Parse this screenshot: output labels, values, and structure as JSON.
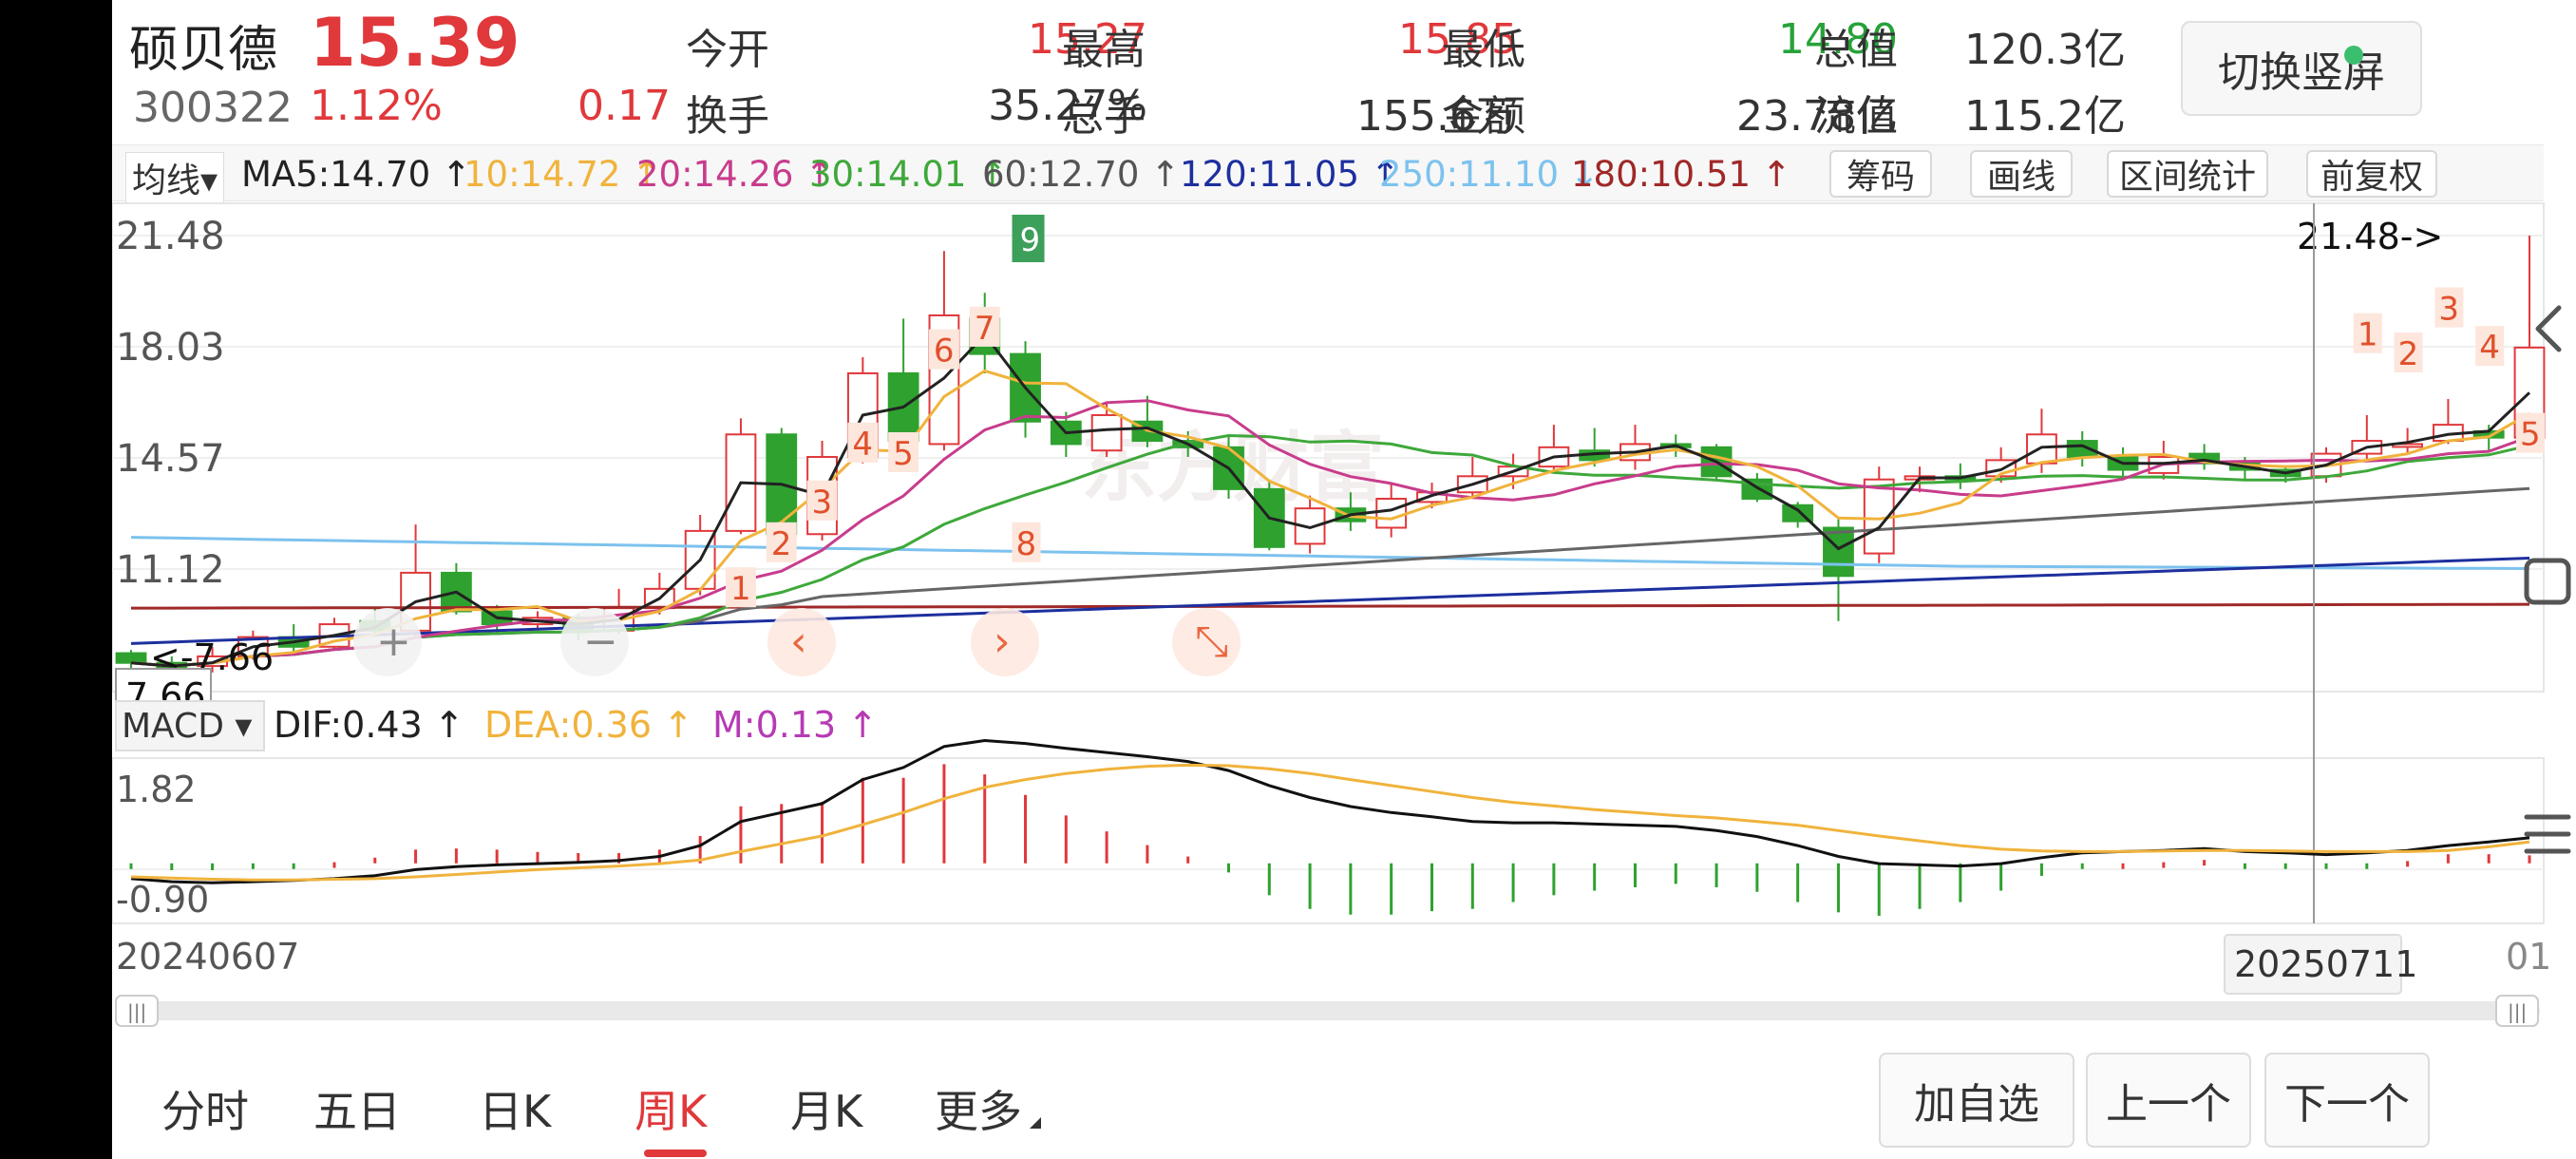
{
  "quote": {
    "name": "硕贝德",
    "price": "15.39",
    "code": "300322",
    "change_pct": "1.12%",
    "change_abs": "0.17",
    "open_label": "今开",
    "open": "15.27",
    "high_label": "最高",
    "high": "15.85",
    "low_label": "最低",
    "low": "14.80",
    "cap_label": "总值",
    "cap": "120.3亿",
    "turnover_label": "换手",
    "turnover": "35.27%",
    "volume_label": "总手",
    "volume": "155.6万",
    "amount_label": "金额",
    "amount": "23.78亿",
    "float_label": "流值",
    "float_cap": "115.2亿",
    "toggle_label": "切换竖屏"
  },
  "ma_bar": {
    "selector": "均线▾",
    "ma5": "MA5:14.70 ↑",
    "ma10": "10:14.72 ↑",
    "ma20": "20:14.26 ↑",
    "ma30": "30:14.01 ↑",
    "ma60": "60:12.70 ↑",
    "ma120": "120:11.05 ↑",
    "ma250": "250:11.10 ↓",
    "ma180": "180:10.51 ↑",
    "chips": "筹码",
    "draw": "画线",
    "range_stats": "区间统计",
    "adjust": "前复权"
  },
  "colors": {
    "up": "#e0383b",
    "down": "#2fa12f",
    "ma5": "#222222",
    "ma10": "#f0b33c",
    "ma20": "#c83c8c",
    "ma30": "#3ea83a",
    "ma60": "#666666",
    "ma120": "#1d2f9e",
    "ma250": "#7cc2ee",
    "ma180": "#a02828"
  },
  "main_chart": {
    "y_labels": [
      "21.48",
      "18.03",
      "14.57",
      "11.12"
    ],
    "max_marker": "21.48->",
    "min_marker": "<-7.66",
    "min_box": "7.66",
    "nine_label": "9",
    "watermark": "东方财富"
  },
  "macd": {
    "selector": "MACD ▾",
    "dif": "DIF:0.43 ↑",
    "dea": "DEA:0.36 ↑",
    "m": "M:0.13 ↑",
    "y_top": "1.82",
    "y_bottom": "-0.90"
  },
  "dates": {
    "start": "20240607",
    "cursor": "20250711",
    "end_partial": "01"
  },
  "tabs": [
    "分时",
    "五日",
    "日K",
    "周K",
    "月K",
    "更多"
  ],
  "active_tab": "周K",
  "buttons": {
    "add_watch": "加自选",
    "prev": "上一个",
    "next": "下一个"
  },
  "chart_data": {
    "type": "candlestick",
    "series": [
      {
        "name": "K",
        "ohlc": [
          [
            8.5,
            8.2,
            8.6,
            8.0
          ],
          [
            8.2,
            8.0,
            8.4,
            7.66
          ],
          [
            8.1,
            8.4,
            8.7,
            7.9
          ],
          [
            8.4,
            9.0,
            9.2,
            8.3
          ],
          [
            9.0,
            8.7,
            9.4,
            8.5
          ],
          [
            8.7,
            9.4,
            9.6,
            8.6
          ],
          [
            9.5,
            9.2,
            9.9,
            9.0
          ],
          [
            9.2,
            11.0,
            12.5,
            9.0
          ],
          [
            11.0,
            9.8,
            11.3,
            9.7
          ],
          [
            9.8,
            9.4,
            10.0,
            9.1
          ],
          [
            9.4,
            9.6,
            9.8,
            9.2
          ],
          [
            9.6,
            9.2,
            9.7,
            8.9
          ],
          [
            9.2,
            9.9,
            10.5,
            9.1
          ],
          [
            9.9,
            10.5,
            11.0,
            9.7
          ],
          [
            10.5,
            12.3,
            12.8,
            10.3
          ],
          [
            12.3,
            15.3,
            15.8,
            12.2
          ],
          [
            15.3,
            12.2,
            15.5,
            12.0
          ],
          [
            12.2,
            14.6,
            15.1,
            12.0
          ],
          [
            14.6,
            17.2,
            17.7,
            14.4
          ],
          [
            17.2,
            15.1,
            18.9,
            14.9
          ],
          [
            15.0,
            19.0,
            21.0,
            14.8
          ],
          [
            18.9,
            17.8,
            19.7,
            17.2
          ],
          [
            17.8,
            15.7,
            18.2,
            15.2
          ],
          [
            15.7,
            15.0,
            16.0,
            14.6
          ],
          [
            14.8,
            15.9,
            16.3,
            14.6
          ],
          [
            15.7,
            15.1,
            16.5,
            14.9
          ],
          [
            15.1,
            14.9,
            15.4,
            14.6
          ],
          [
            14.9,
            13.6,
            15.3,
            13.3
          ],
          [
            13.6,
            11.8,
            13.9,
            11.7
          ],
          [
            11.9,
            13.0,
            13.4,
            11.6
          ],
          [
            13.0,
            12.6,
            13.5,
            12.3
          ],
          [
            12.4,
            13.3,
            13.8,
            12.1
          ],
          [
            13.2,
            13.5,
            13.8,
            13.0
          ],
          [
            13.5,
            14.0,
            14.6,
            13.3
          ],
          [
            14.0,
            14.3,
            14.7,
            13.6
          ],
          [
            14.3,
            14.9,
            15.6,
            14.1
          ],
          [
            14.8,
            14.5,
            15.5,
            14.3
          ],
          [
            14.5,
            15.0,
            15.6,
            14.2
          ],
          [
            15.0,
            14.9,
            15.3,
            14.6
          ],
          [
            14.9,
            14.0,
            15.0,
            13.9
          ],
          [
            13.9,
            13.3,
            14.1,
            13.2
          ],
          [
            13.1,
            12.6,
            13.2,
            12.4
          ],
          [
            12.4,
            10.9,
            12.7,
            9.5
          ],
          [
            11.6,
            13.9,
            14.3,
            11.3
          ],
          [
            13.9,
            14.0,
            14.3,
            13.5
          ],
          [
            14.0,
            13.9,
            14.4,
            13.6
          ],
          [
            14.0,
            14.5,
            14.9,
            13.8
          ],
          [
            14.4,
            15.3,
            16.1,
            14.1
          ],
          [
            15.1,
            14.6,
            15.4,
            14.3
          ],
          [
            14.6,
            14.2,
            14.9,
            14.0
          ],
          [
            14.1,
            14.6,
            15.1,
            13.9
          ],
          [
            14.7,
            14.4,
            15.0,
            14.2
          ],
          [
            14.4,
            14.2,
            14.6,
            13.9
          ],
          [
            14.2,
            14.0,
            14.3,
            13.8
          ],
          [
            14.0,
            14.7,
            14.9,
            13.8
          ],
          [
            14.7,
            15.1,
            15.9,
            14.5
          ],
          [
            15.0,
            15.0,
            15.5,
            14.7
          ],
          [
            15.1,
            15.6,
            16.4,
            15.0
          ],
          [
            15.4,
            15.2,
            15.6,
            14.8
          ],
          [
            15.2,
            18.0,
            21.48,
            14.8
          ]
        ]
      }
    ],
    "y_ticks": [
      21.48,
      18.03,
      14.57,
      11.12
    ],
    "ylim": [
      7.66,
      21.48
    ],
    "macd_ylim": [
      -0.9,
      1.82
    ],
    "dif": [
      -0.25,
      -0.3,
      -0.32,
      -0.3,
      -0.28,
      -0.25,
      -0.2,
      -0.1,
      -0.05,
      -0.02,
      0.0,
      0.02,
      0.05,
      0.12,
      0.3,
      0.7,
      0.85,
      1.0,
      1.4,
      1.6,
      1.95,
      2.05,
      2.0,
      1.92,
      1.85,
      1.78,
      1.7,
      1.55,
      1.3,
      1.1,
      0.95,
      0.85,
      0.78,
      0.7,
      0.68,
      0.68,
      0.66,
      0.64,
      0.62,
      0.55,
      0.45,
      0.3,
      0.12,
      0.0,
      -0.02,
      -0.04,
      0.0,
      0.1,
      0.18,
      0.2,
      0.22,
      0.25,
      0.2,
      0.18,
      0.15,
      0.18,
      0.22,
      0.3,
      0.36,
      0.43
    ],
    "dea": [
      -0.22,
      -0.24,
      -0.26,
      -0.27,
      -0.27,
      -0.26,
      -0.25,
      -0.22,
      -0.18,
      -0.14,
      -0.1,
      -0.07,
      -0.04,
      0.0,
      0.06,
      0.2,
      0.33,
      0.46,
      0.65,
      0.85,
      1.08,
      1.27,
      1.4,
      1.5,
      1.57,
      1.62,
      1.64,
      1.63,
      1.58,
      1.5,
      1.4,
      1.3,
      1.2,
      1.1,
      1.02,
      0.96,
      0.9,
      0.85,
      0.8,
      0.76,
      0.7,
      0.64,
      0.55,
      0.46,
      0.38,
      0.3,
      0.24,
      0.21,
      0.2,
      0.2,
      0.21,
      0.22,
      0.22,
      0.21,
      0.2,
      0.2,
      0.2,
      0.22,
      0.28,
      0.36
    ]
  }
}
